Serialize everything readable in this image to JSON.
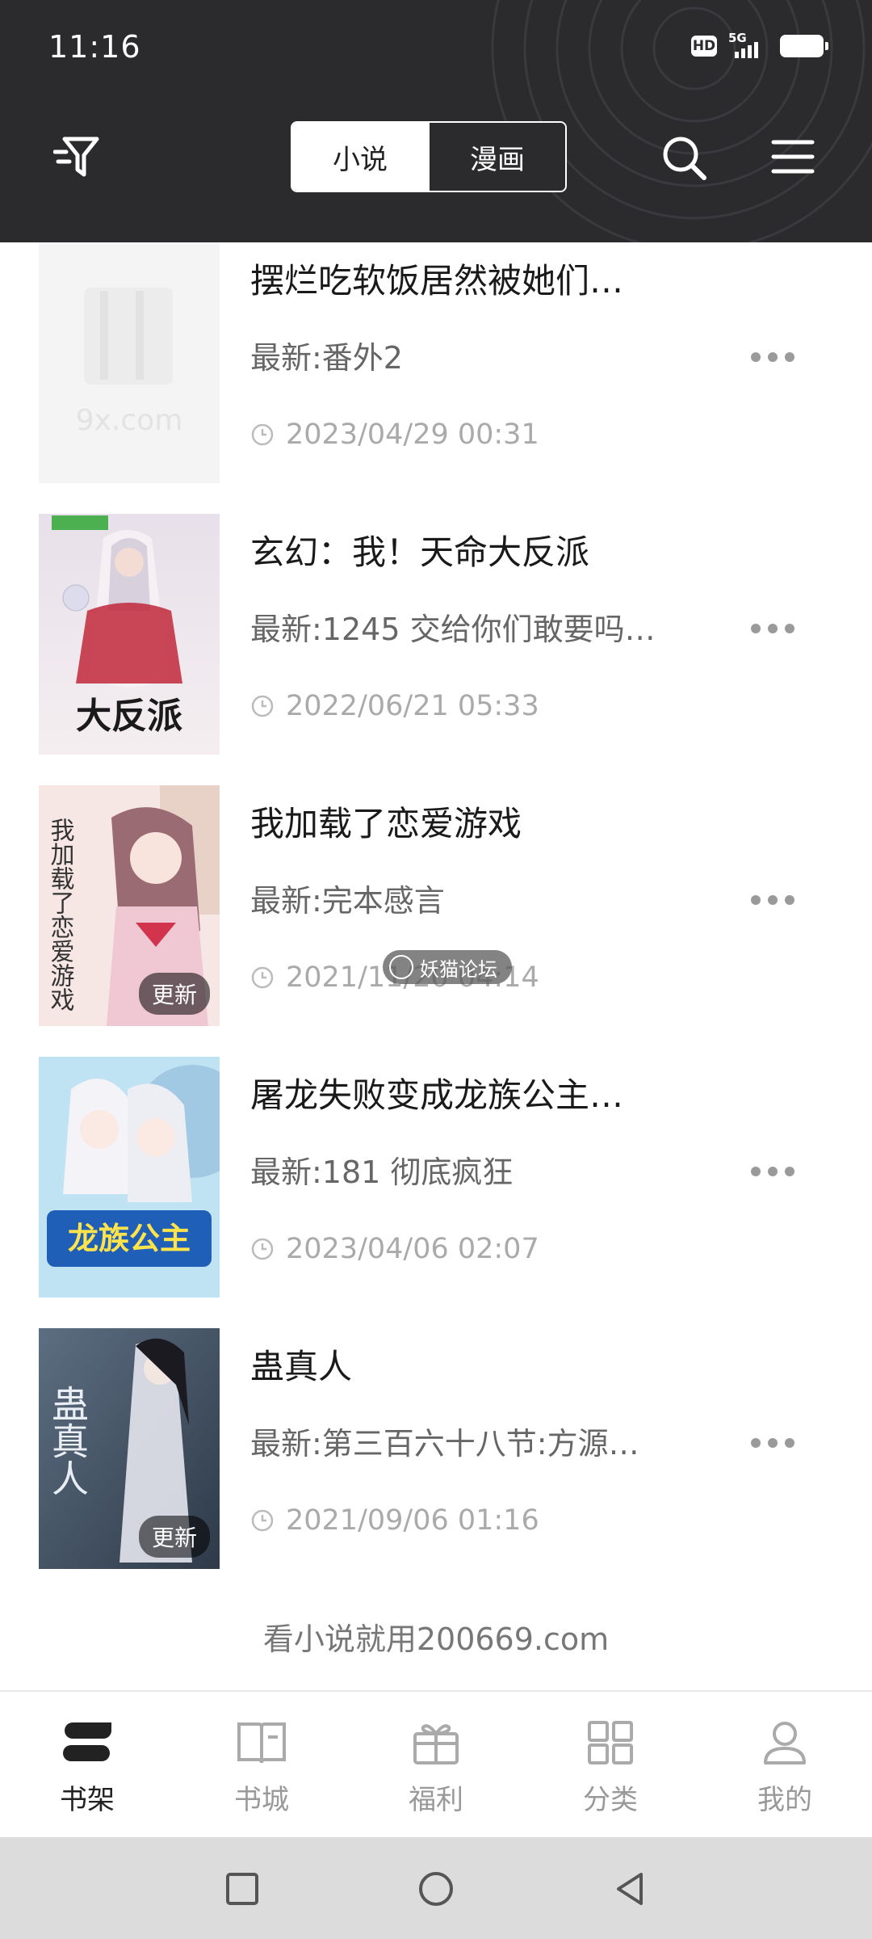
{
  "status_bar": {
    "time": "11:16",
    "hd": "HD",
    "network": "5G"
  },
  "header": {
    "tabs": [
      {
        "label": "小说",
        "active": true
      },
      {
        "label": "漫画",
        "active": false
      }
    ]
  },
  "books": [
    {
      "title": "摆烂吃软饭居然被她们…",
      "latest": "最新:番外2",
      "time": "2023/04/29 00:31",
      "update": "",
      "placeholder": "9x.com"
    },
    {
      "title": "玄幻：我！天命大反派",
      "latest": "最新:1245 交给你们敢要吗…",
      "time": "2022/06/21 05:33",
      "update": "",
      "cover_text": "大反派"
    },
    {
      "title": "我加载了恋爱游戏",
      "latest": "最新:完本感言",
      "time": "2021/11/20 04:14",
      "update": "更新",
      "cover_text": "我加载了恋爱游戏"
    },
    {
      "title": "屠龙失败变成龙族公主…",
      "latest": "最新:181 彻底疯狂",
      "time": "2023/04/06 02:07",
      "update": "",
      "cover_text": "龙族公主"
    },
    {
      "title": "蛊真人",
      "latest": "最新:第三百六十八节:方源…",
      "time": "2021/09/06 01:16",
      "update": "更新",
      "cover_text": "蛊真人"
    }
  ],
  "footer_note": "看小说就用200669.com",
  "watermark": "妖猫论坛",
  "bottom_nav": [
    {
      "label": "书架",
      "icon": "bookshelf-icon",
      "active": true
    },
    {
      "label": "书城",
      "icon": "open-book-icon",
      "active": false
    },
    {
      "label": "福利",
      "icon": "gift-icon",
      "active": false
    },
    {
      "label": "分类",
      "icon": "grid-icon",
      "active": false
    },
    {
      "label": "我的",
      "icon": "user-icon",
      "active": false
    }
  ]
}
